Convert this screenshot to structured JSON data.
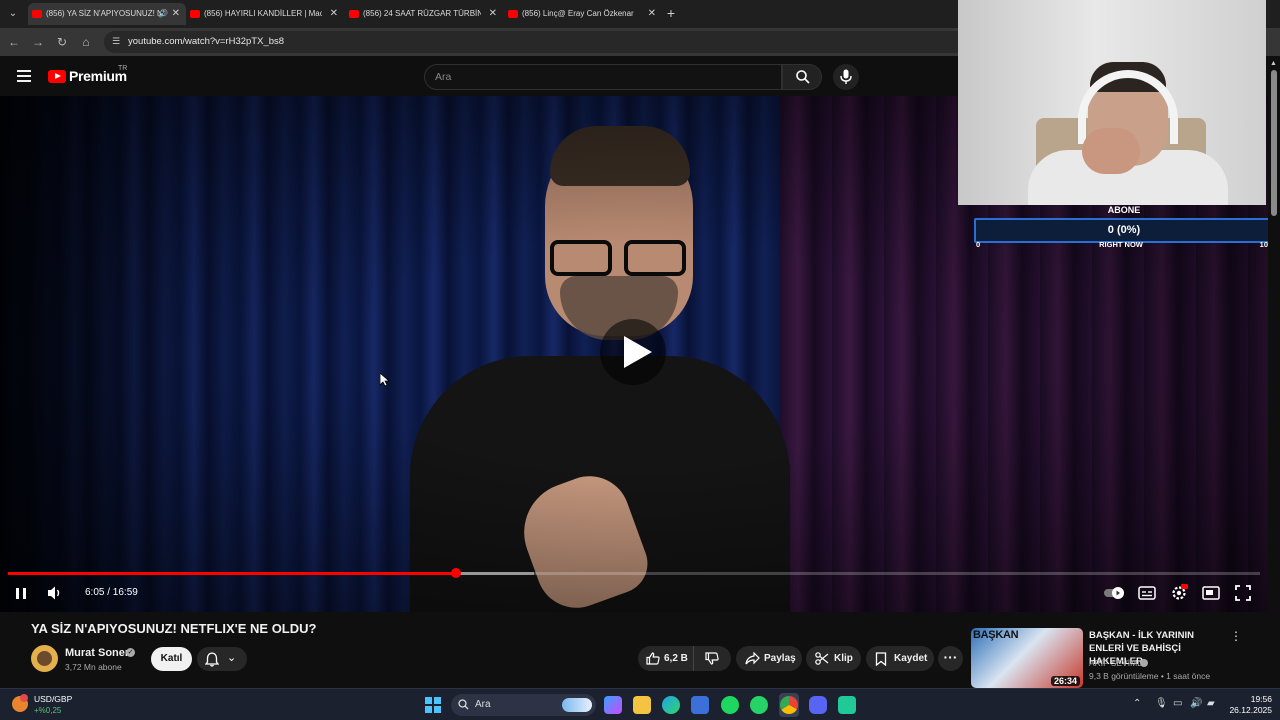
{
  "browser": {
    "tabs": [
      {
        "title": "(856) YA SİZ N'APIYOSUNUZ! NETFLIX'E NE OLDU?",
        "active": true,
        "audio": true
      },
      {
        "title": "(856) HAYIRLI KANDİLLER | Mac",
        "active": false,
        "audio": false
      },
      {
        "title": "(856) 24 SAAT RÜZGAR TÜRBİNİ",
        "active": false,
        "audio": false
      },
      {
        "title": "(856) Linç@ Eray Can Özkenar",
        "active": false,
        "audio": false
      }
    ],
    "url": "youtube.com/watch?v=rH32pTX_bs8"
  },
  "youtube": {
    "logo_text": "Premium",
    "country_code": "TR",
    "search_placeholder": "Ara"
  },
  "overlay": {
    "title": "ABONE",
    "count": "0 (0%)",
    "min": "0",
    "max": "10",
    "label": "RIGHT NOW"
  },
  "player": {
    "current_time": "6:05",
    "duration": "16:59",
    "time_display": "6:05 / 16:59",
    "played_fraction": 0.358,
    "buffered_fraction": 0.42,
    "autoplay_on": true
  },
  "video": {
    "title": "YA SİZ N'APIYOSUNUZ! NETFLIX'E NE OLDU?",
    "channel": "Murat Soner",
    "subscribers": "3,72 Mn abone",
    "join_label": "Katıl",
    "likes": "6,2 B",
    "share_label": "Paylaş",
    "clip_label": "Klip",
    "save_label": "Kaydet"
  },
  "recommendation": {
    "thumb_text": "BAŞKAN",
    "duration": "26:34",
    "title": "BAŞKAN - İLK YARININ ENLERİ VE BAHİSÇİ HAKEMLER",
    "channel": "ARİF SEVİMLİ",
    "meta": "9,3 B görüntüleme • 1 saat önce"
  },
  "taskbar": {
    "ticker_name": "USD/GBP",
    "ticker_change": "+%0,25",
    "search_label": "Ara",
    "time": "19:56",
    "date": "26.12.2025"
  },
  "colors": {
    "youtube_red": "#ff0000",
    "progress_red": "#ff0000",
    "overlay_blue": "#2a6fd6",
    "ticker_green": "#57c27a"
  }
}
